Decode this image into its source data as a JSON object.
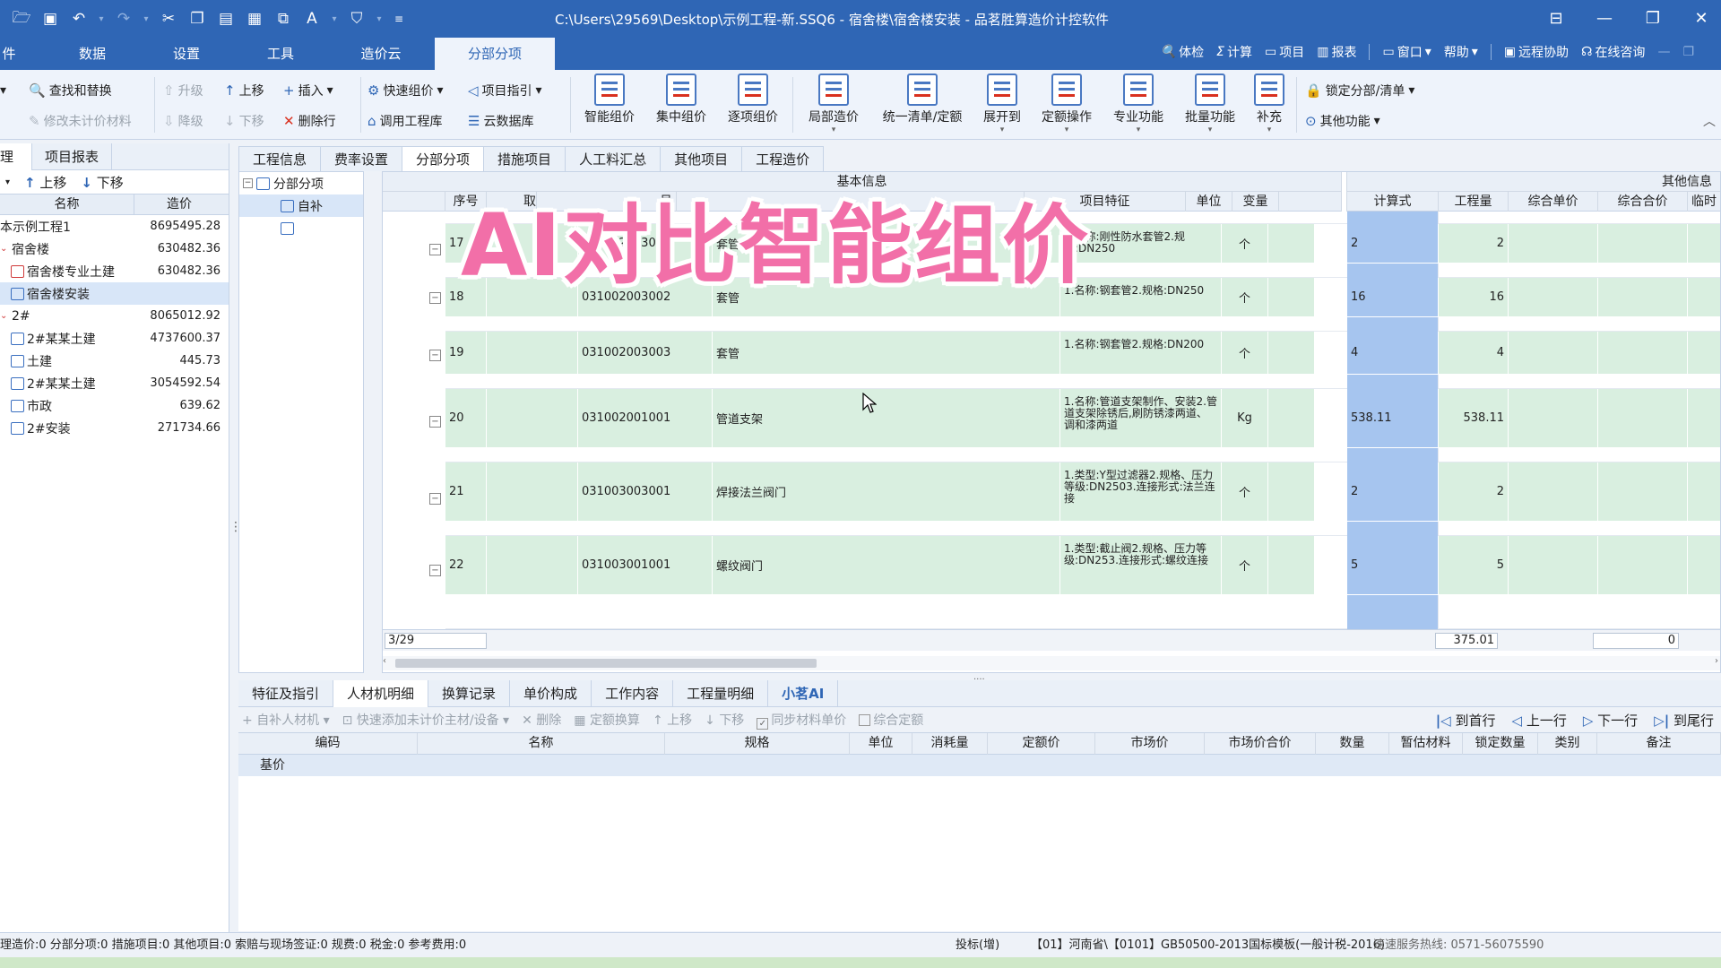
{
  "window": {
    "title": "C:\\Users\\29569\\Desktop\\示例工程-新.SSQ6 - 宿舍楼\\宿舍楼安装 - 品茗胜算造价计控软件"
  },
  "ribbon_tabs": [
    "件",
    "数据",
    "设置",
    "工具",
    "造价云",
    "分部分项"
  ],
  "ribbon_right": [
    "体检",
    "计算",
    "项目",
    "报表",
    "窗口",
    "帮助",
    "远程协助",
    "在线咨询"
  ],
  "ribbon": {
    "find_replace": "查找和替换",
    "upgrade": "升级",
    "move_up": "上移",
    "insert": "插入",
    "quick_price": "快速组价",
    "item_guide": "项目指引",
    "edit_material": "修改未计价材料",
    "downgrade": "降级",
    "move_down": "下移",
    "delete_row": "删除行",
    "call_library": "调用工程库",
    "cloud_db": "云数据库",
    "big_buttons": [
      "智能组价",
      "集中组价",
      "逐项组价",
      "局部造价",
      "统一清单/定额",
      "展开到",
      "定额操作",
      "专业功能",
      "批量功能",
      "补充"
    ],
    "lock": "锁定分部/清单",
    "other": "其他功能"
  },
  "left_panel": {
    "tabs": [
      "理",
      "项目报表"
    ],
    "move_up": "上移",
    "move_down": "下移",
    "col_name": "名称",
    "col_cost": "造价",
    "rows": [
      {
        "name": "本示例工程1",
        "cost": "8695495.28"
      },
      {
        "name": "宿舍楼",
        "cost": "630482.36"
      },
      {
        "name": "宿舍楼专业土建",
        "cost": "630482.36"
      },
      {
        "name": "宿舍楼安装",
        "cost": ""
      },
      {
        "name": "2#",
        "cost": "8065012.92"
      },
      {
        "name": "2#某某土建",
        "cost": "4737600.37"
      },
      {
        "name": "土建",
        "cost": "445.73"
      },
      {
        "name": "2#某某土建",
        "cost": "3054592.54"
      },
      {
        "name": "市政",
        "cost": "639.62"
      },
      {
        "name": "2#安装",
        "cost": "271734.66"
      }
    ]
  },
  "sub_tabs": [
    "工程信息",
    "费率设置",
    "分部分项",
    "措施项目",
    "人工料汇总",
    "其他项目",
    "工程造价"
  ],
  "tree": {
    "root": "分部分项",
    "child": "自补"
  },
  "grid": {
    "group_basic": "基本信息",
    "group_other": "其他信息",
    "headers": [
      "序号",
      "取",
      "号",
      "项目特征",
      "单位",
      "变量",
      "计算式",
      "工程量",
      "综合单价",
      "综合合价",
      "临时"
    ],
    "rows": [
      {
        "seq": "17",
        "code": "031002003001",
        "name": "套管",
        "feature": "1.名称:刚性防水套管2.规格:DN250",
        "unit": "个",
        "formula": "2",
        "qty": "2"
      },
      {
        "seq": "18",
        "code": "031002003002",
        "name": "套管",
        "feature": "1.名称:钢套管2.规格:DN250",
        "unit": "个",
        "formula": "16",
        "qty": "16"
      },
      {
        "seq": "19",
        "code": "031002003003",
        "name": "套管",
        "feature": "1.名称:钢套管2.规格:DN200",
        "unit": "个",
        "formula": "4",
        "qty": "4"
      },
      {
        "seq": "20",
        "code": "031002001001",
        "name": "管道支架",
        "feature": "1.名称:管道支架制作、安装2.管道支架除锈后,刷防锈漆两道、调和漆两道",
        "unit": "Kg",
        "formula": "538.11",
        "qty": "538.11"
      },
      {
        "seq": "21",
        "code": "031003003001",
        "name": "焊接法兰阀门",
        "feature": "1.类型:Y型过滤器2.规格、压力等级:DN2503.连接形式:法兰连接",
        "unit": "个",
        "formula": "2",
        "qty": "2"
      },
      {
        "seq": "22",
        "code": "031003001001",
        "name": "螺纹阀门",
        "feature": "1.类型:截止阀2.规格、压力等级:DN253.连接形式:螺纹连接",
        "unit": "个",
        "formula": "5",
        "qty": "5"
      }
    ],
    "footer_page": "3/29",
    "footer_qty": "375.01",
    "footer_total": "0"
  },
  "overlay_title": "AI对比智能组价",
  "bottom_tabs": [
    "特征及指引",
    "人材机明细",
    "换算记录",
    "单价构成",
    "工作内容",
    "工程量明细",
    "小茗AI"
  ],
  "bottom_toolbar": {
    "add_self": "自补人材机",
    "quick_add": "快速添加未计价主材/设备",
    "delete": "删除",
    "quota_conv": "定额换算",
    "up": "上移",
    "down": "下移",
    "sync": "同步材料单价",
    "composite": "综合定额",
    "first": "到首行",
    "prev": "上一行",
    "next": "下一行",
    "last": "到尾行"
  },
  "bottom_grid": {
    "headers": [
      "编码",
      "名称",
      "规格",
      "单位",
      "消耗量",
      "定额价",
      "市场价",
      "市场价合价",
      "数量",
      "暂估材料",
      "锁定数量",
      "类别",
      "备注"
    ],
    "row_label": "基价"
  },
  "status": {
    "left": "理造价:0 分部分项:0 措施项目:0 其他项目:0 索赔与现场签证:0 规费:0 税金:0 参考费用:0",
    "mode": "投标(增)",
    "template": "【01】河南省\\【0101】GB50500-2013国标模板(一般计税-2016)",
    "hotline": "速速服务热线: 0571-56075590"
  },
  "colors": {
    "titlebar": "#2f66b5",
    "row_green": "#d9efe0",
    "calc_blue": "#a6c5ef",
    "overlay": "#f26fa8"
  }
}
